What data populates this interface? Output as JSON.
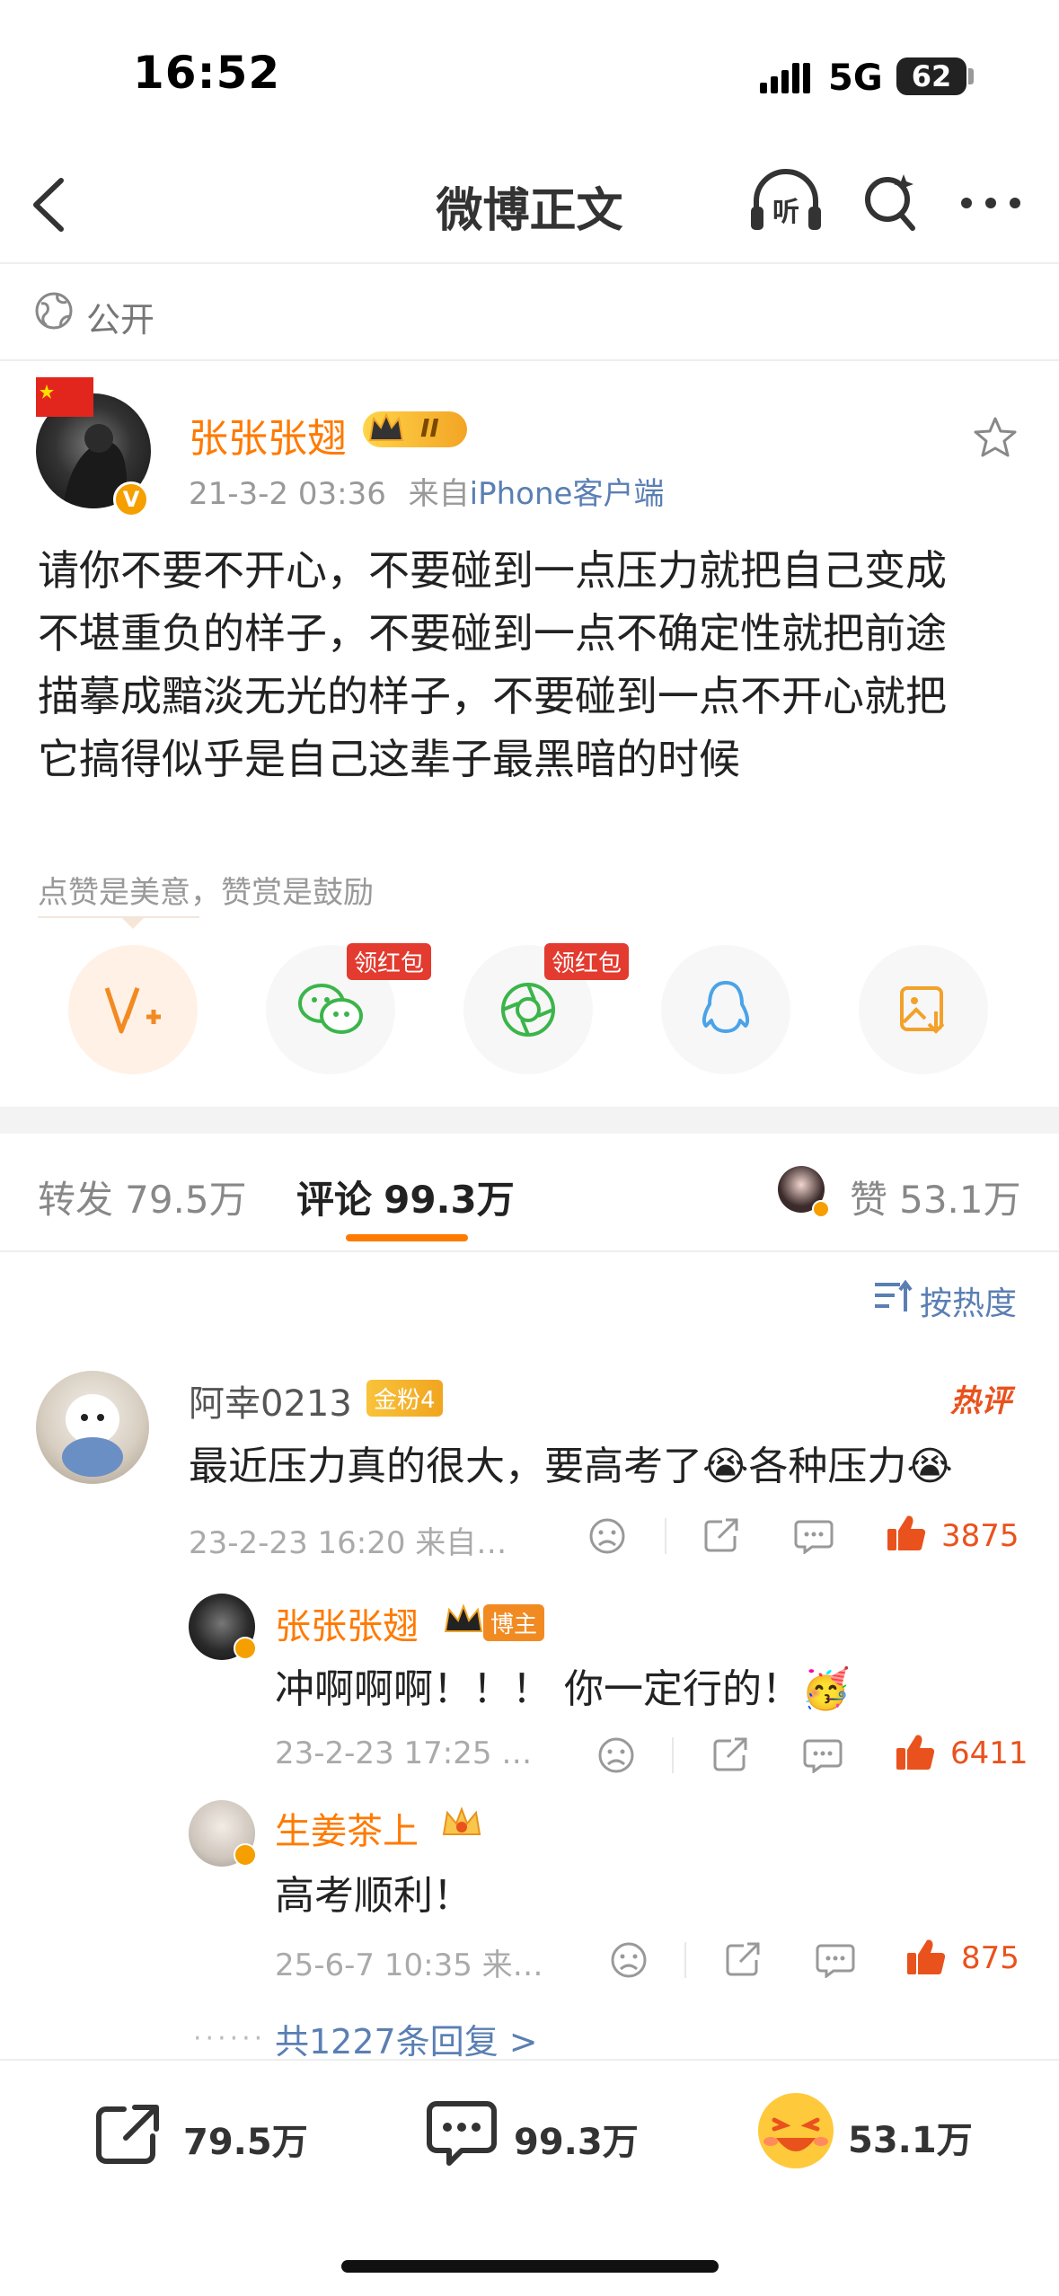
{
  "status_bar": {
    "time": "16:52",
    "network": "5G",
    "battery": "62"
  },
  "nav": {
    "title": "微博正文",
    "back_icon": "chevron-left-icon",
    "listen_label": "听",
    "search_icon": "search-icon",
    "more_icon": "more-icon"
  },
  "visibility": {
    "label": "公开",
    "icon": "globe-icon"
  },
  "post": {
    "author": "张张张翅",
    "level_badge": "II",
    "time": "21-3-2 03:36",
    "source_prefix": "来自",
    "source": "iPhone客户端",
    "text_lines": [
      "请你不要不开心，不要碰到一点压力就把自己变成",
      "不堪重负的样子，不要碰到一点不确定性就把前途",
      "描摹成黯淡无光的样子，不要碰到一点不开心就把",
      "它搞得似乎是自己这辈子最黑暗的时候"
    ],
    "encourage_text": "点赞是美意，赞赏是鼓励",
    "share_badges": [
      "领红包",
      "领红包"
    ]
  },
  "tabs": {
    "repost_label": "转发",
    "repost_count": "79.5万",
    "comment_label": "评论",
    "comment_count": "99.3万",
    "like_label": "赞",
    "like_count": "53.1万"
  },
  "sort_label": "按热度",
  "comments": [
    {
      "user": "阿幸0213",
      "fan_badge": "金粉4",
      "hot_tag": "热评",
      "text": "最近压力真的很大，要高考了😭各种压力😭",
      "time": "23-2-23 16:20 来自…",
      "likes": "3875"
    }
  ],
  "replies": [
    {
      "user": "张张张翅",
      "role_badge": "博主",
      "text": "冲啊啊啊！！！ 你一定行的！🥳",
      "time": "23-2-23 17:25 …",
      "likes": "6411"
    },
    {
      "user": "生姜茶上",
      "text": "高考顺利！",
      "time": "25-6-7 10:35 来…",
      "likes": "875"
    }
  ],
  "more_replies": "共1227条回复 >",
  "more_dots": "······",
  "bottom_bar": {
    "repost": "79.5万",
    "comment": "99.3万",
    "like": "53.1万"
  },
  "colors": {
    "accent": "#ff7a00",
    "link": "#5a7fb3",
    "like": "#e9521d",
    "wechat": "#3bb54a",
    "qq": "#4aa3e8"
  }
}
